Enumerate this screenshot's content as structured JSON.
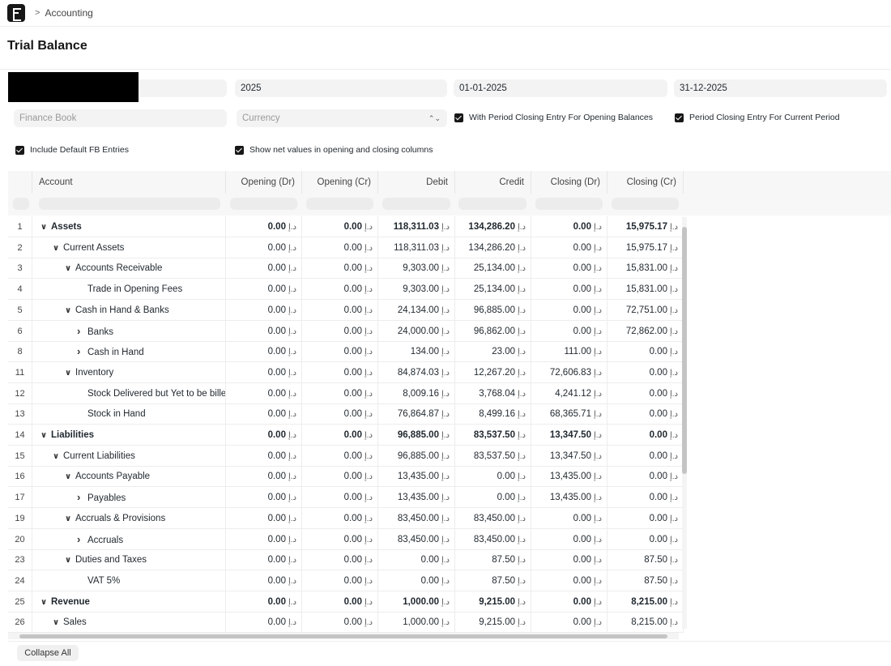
{
  "breadcrumb": {
    "separator": ">",
    "module": "Accounting"
  },
  "page": {
    "title": "Trial Balance"
  },
  "filters": {
    "fiscal_year": "2025",
    "from_date": "01-01-2025",
    "to_date": "31-12-2025",
    "finance_book_placeholder": "Finance Book",
    "currency_placeholder": "Currency",
    "currency_arrows": "⌃⌄",
    "with_period_closing_opening": "With Period Closing Entry For Opening Balances",
    "period_closing_current": "Period Closing Entry For Current Period",
    "include_default_fb": "Include Default FB Entries",
    "show_net_values": "Show net values in opening and closing columns"
  },
  "table": {
    "currency_symbol": "د.إ",
    "columns": [
      "Account",
      "Opening (Dr)",
      "Opening (Cr)",
      "Debit",
      "Credit",
      "Closing (Dr)",
      "Closing (Cr)"
    ],
    "rows": [
      {
        "idx": "1",
        "level": 0,
        "toggle": "down",
        "bold": true,
        "account": "Assets",
        "values": [
          "0.00",
          "0.00",
          "118,311.03",
          "134,286.20",
          "0.00",
          "15,975.17"
        ]
      },
      {
        "idx": "2",
        "level": 1,
        "toggle": "down",
        "bold": false,
        "account": "Current Assets",
        "values": [
          "0.00",
          "0.00",
          "118,311.03",
          "134,286.20",
          "0.00",
          "15,975.17"
        ]
      },
      {
        "idx": "3",
        "level": 2,
        "toggle": "down",
        "bold": false,
        "account": "Accounts Receivable",
        "values": [
          "0.00",
          "0.00",
          "9,303.00",
          "25,134.00",
          "0.00",
          "15,831.00"
        ]
      },
      {
        "idx": "4",
        "level": 3,
        "toggle": "none",
        "bold": false,
        "account": "Trade in Opening Fees",
        "values": [
          "0.00",
          "0.00",
          "9,303.00",
          "25,134.00",
          "0.00",
          "15,831.00"
        ]
      },
      {
        "idx": "5",
        "level": 2,
        "toggle": "down",
        "bold": false,
        "account": "Cash in Hand & Banks",
        "values": [
          "0.00",
          "0.00",
          "24,134.00",
          "96,885.00",
          "0.00",
          "72,751.00"
        ]
      },
      {
        "idx": "6",
        "level": 3,
        "toggle": "right",
        "bold": false,
        "account": "Banks",
        "values": [
          "0.00",
          "0.00",
          "24,000.00",
          "96,862.00",
          "0.00",
          "72,862.00"
        ]
      },
      {
        "idx": "8",
        "level": 3,
        "toggle": "right",
        "bold": false,
        "account": "Cash in Hand",
        "values": [
          "0.00",
          "0.00",
          "134.00",
          "23.00",
          "111.00",
          "0.00"
        ]
      },
      {
        "idx": "11",
        "level": 2,
        "toggle": "down",
        "bold": false,
        "account": "Inventory",
        "values": [
          "0.00",
          "0.00",
          "84,874.03",
          "12,267.20",
          "72,606.83",
          "0.00"
        ]
      },
      {
        "idx": "12",
        "level": 3,
        "toggle": "none",
        "bold": false,
        "account": "Stock Delivered but Yet to be billed",
        "values": [
          "0.00",
          "0.00",
          "8,009.16",
          "3,768.04",
          "4,241.12",
          "0.00"
        ]
      },
      {
        "idx": "13",
        "level": 3,
        "toggle": "none",
        "bold": false,
        "account": "Stock in Hand",
        "values": [
          "0.00",
          "0.00",
          "76,864.87",
          "8,499.16",
          "68,365.71",
          "0.00"
        ]
      },
      {
        "idx": "14",
        "level": 0,
        "toggle": "down",
        "bold": true,
        "account": "Liabilities",
        "values": [
          "0.00",
          "0.00",
          "96,885.00",
          "83,537.50",
          "13,347.50",
          "0.00"
        ]
      },
      {
        "idx": "15",
        "level": 1,
        "toggle": "down",
        "bold": false,
        "account": "Current Liabilities",
        "values": [
          "0.00",
          "0.00",
          "96,885.00",
          "83,537.50",
          "13,347.50",
          "0.00"
        ]
      },
      {
        "idx": "16",
        "level": 2,
        "toggle": "down",
        "bold": false,
        "account": "Accounts Payable",
        "values": [
          "0.00",
          "0.00",
          "13,435.00",
          "0.00",
          "13,435.00",
          "0.00"
        ]
      },
      {
        "idx": "17",
        "level": 3,
        "toggle": "right",
        "bold": false,
        "account": "Payables",
        "values": [
          "0.00",
          "0.00",
          "13,435.00",
          "0.00",
          "13,435.00",
          "0.00"
        ]
      },
      {
        "idx": "19",
        "level": 2,
        "toggle": "down",
        "bold": false,
        "account": "Accruals & Provisions",
        "values": [
          "0.00",
          "0.00",
          "83,450.00",
          "83,450.00",
          "0.00",
          "0.00"
        ]
      },
      {
        "idx": "20",
        "level": 3,
        "toggle": "right",
        "bold": false,
        "account": "Accruals",
        "values": [
          "0.00",
          "0.00",
          "83,450.00",
          "83,450.00",
          "0.00",
          "0.00"
        ]
      },
      {
        "idx": "23",
        "level": 2,
        "toggle": "down",
        "bold": false,
        "account": "Duties and Taxes",
        "values": [
          "0.00",
          "0.00",
          "0.00",
          "87.50",
          "0.00",
          "87.50"
        ]
      },
      {
        "idx": "24",
        "level": 3,
        "toggle": "none",
        "bold": false,
        "account": "VAT 5%",
        "values": [
          "0.00",
          "0.00",
          "0.00",
          "87.50",
          "0.00",
          "87.50"
        ]
      },
      {
        "idx": "25",
        "level": 0,
        "toggle": "down",
        "bold": true,
        "account": "Revenue",
        "values": [
          "0.00",
          "0.00",
          "1,000.00",
          "9,215.00",
          "0.00",
          "8,215.00"
        ]
      },
      {
        "idx": "26",
        "level": 1,
        "toggle": "down",
        "bold": false,
        "account": "Sales",
        "values": [
          "0.00",
          "0.00",
          "1,000.00",
          "9,215.00",
          "0.00",
          "8,215.00"
        ]
      }
    ]
  },
  "footer": {
    "collapse_all": "Collapse All"
  }
}
